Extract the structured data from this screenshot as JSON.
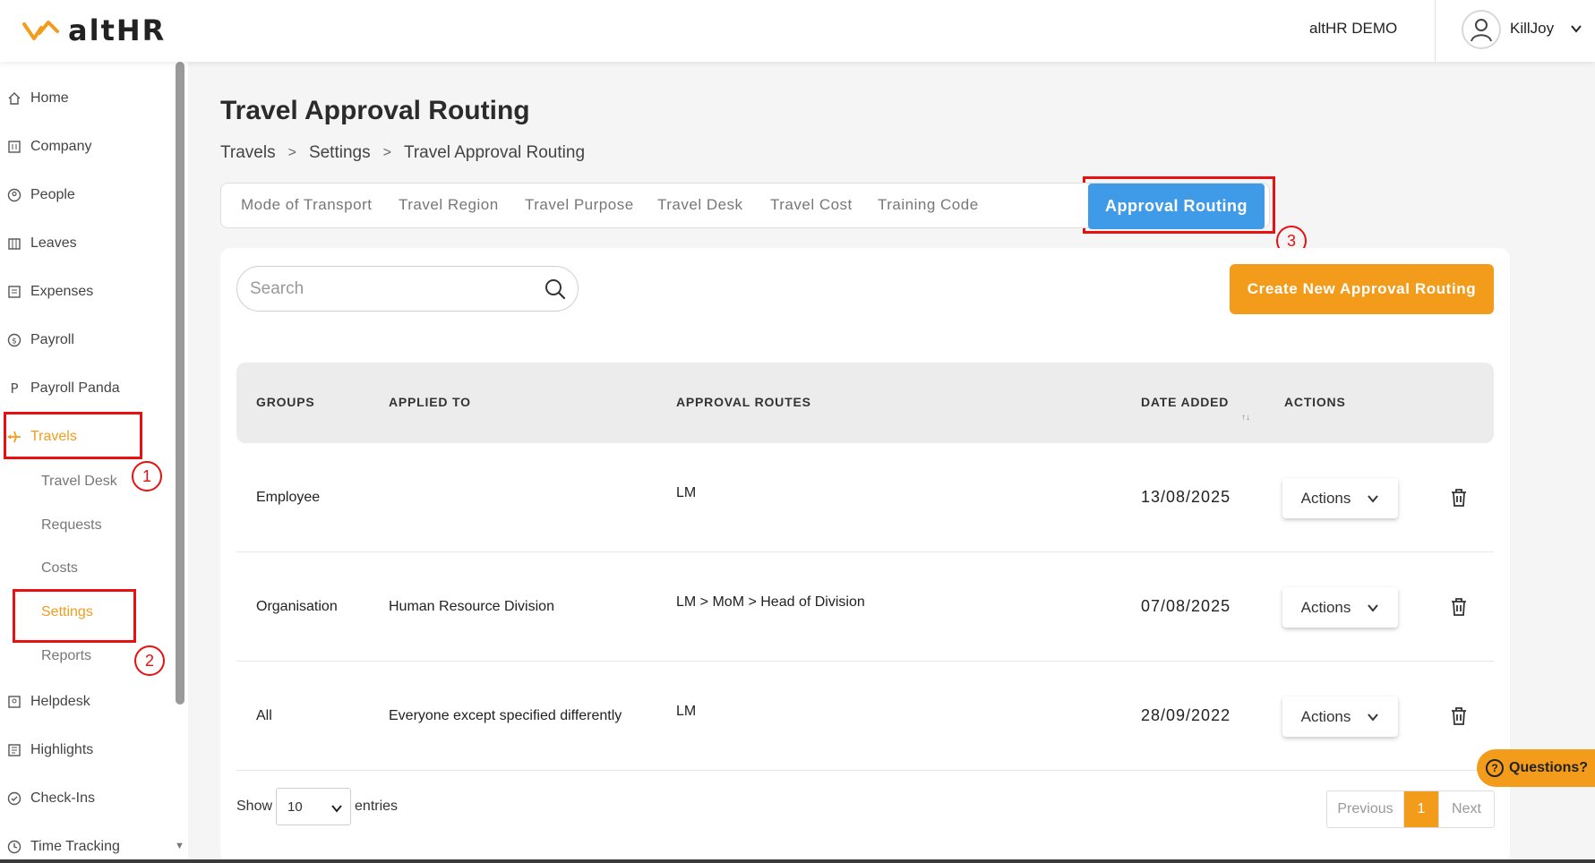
{
  "app": {
    "logo_text": "altHR",
    "company": "altHR DEMO",
    "user": "KillJoy"
  },
  "sidebar": {
    "items": [
      {
        "label": "Home",
        "icon": "home-icon"
      },
      {
        "label": "Company",
        "icon": "building-icon"
      },
      {
        "label": "People",
        "icon": "person-circle-icon"
      },
      {
        "label": "Leaves",
        "icon": "calendar-icon"
      },
      {
        "label": "Expenses",
        "icon": "receipt-icon"
      },
      {
        "label": "Payroll",
        "icon": "dollar-circle-icon"
      },
      {
        "label": "Payroll Panda",
        "icon": "p-icon"
      },
      {
        "label": "Travels",
        "icon": "airplane-icon"
      },
      {
        "label": "Helpdesk",
        "icon": "helpdesk-icon"
      },
      {
        "label": "Highlights",
        "icon": "highlights-icon"
      },
      {
        "label": "Check-Ins",
        "icon": "check-circle-icon"
      },
      {
        "label": "Time Tracking",
        "icon": "clock-icon"
      }
    ],
    "travel_sub": [
      "Travel Desk",
      "Requests",
      "Costs",
      "Settings",
      "Reports"
    ],
    "accent_color": "#f39c1c"
  },
  "annotations": [
    "1",
    "2",
    "3"
  ],
  "page": {
    "title": "Travel Approval Routing",
    "breadcrumb": [
      "Travels",
      "Settings",
      "Travel Approval Routing"
    ],
    "breadcrumb_sep": ">"
  },
  "tabs": {
    "items": [
      "Mode of Transport",
      "Travel Region",
      "Travel Purpose",
      "Travel Desk",
      "Travel Cost",
      "Training Code"
    ],
    "active": "Approval Routing",
    "active_color": "#3f9be8"
  },
  "search": {
    "placeholder": "Search"
  },
  "create_button": "Create New Approval Routing",
  "table": {
    "headers": [
      "GROUPS",
      "APPLIED TO",
      "APPROVAL ROUTES",
      "DATE ADDED",
      "ACTIONS"
    ],
    "sort_indicator": "↑↓",
    "rows": [
      {
        "group": "Employee",
        "applied_to": "",
        "route": "LM",
        "date": "13/08/2025",
        "action": "Actions"
      },
      {
        "group": "Organisation",
        "applied_to": "Human Resource Division",
        "route": "LM > MoM > Head of Division",
        "date": "07/08/2025",
        "action": "Actions"
      },
      {
        "group": "All",
        "applied_to": "Everyone except specified differently",
        "route": "LM",
        "date": "28/09/2022",
        "action": "Actions"
      }
    ]
  },
  "footer": {
    "show_label": "Show",
    "entries_value": "10",
    "entries_label": "entries",
    "prev": "Previous",
    "current_page": "1",
    "next": "Next"
  },
  "help": {
    "label": "Questions?",
    "icon_text": "?"
  }
}
